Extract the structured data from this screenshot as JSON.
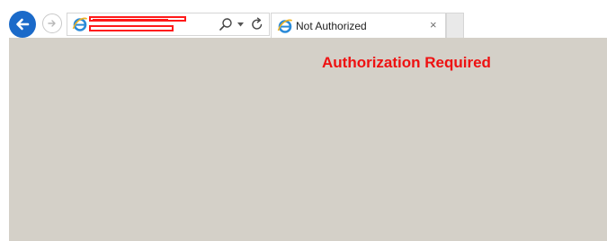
{
  "browser": {
    "tab": {
      "title": "Not Authorized",
      "close_glyph": "×",
      "icon": "ie-logo-icon"
    },
    "address_bar": {
      "icon": "ie-logo-icon",
      "url_redacted": true
    },
    "icons": [
      "back-arrow-icon",
      "forward-arrow-icon",
      "search-icon",
      "chevron-down-icon",
      "refresh-icon"
    ]
  },
  "page": {
    "heading": "Authorization Required",
    "background_color": "#d4d0c8",
    "heading_color": "#ee1111"
  },
  "colors": {
    "accent": "#1b6ac9",
    "redaction": "#ff1a1a"
  }
}
